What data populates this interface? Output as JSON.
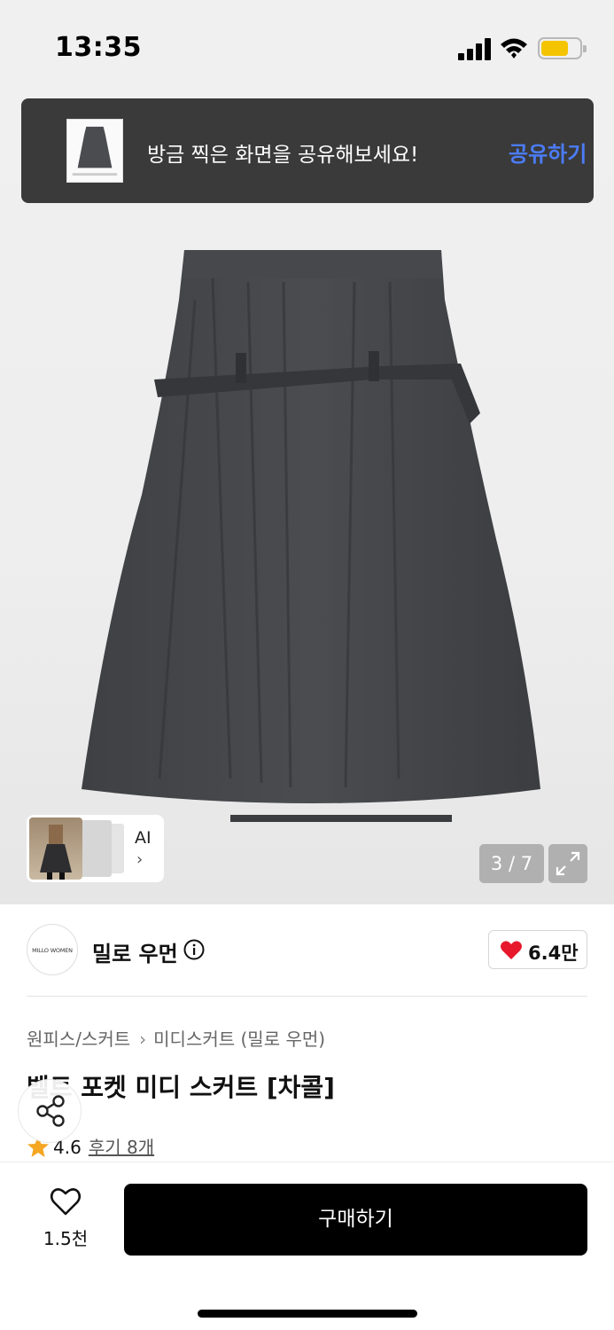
{
  "status_bar": {
    "time": "13:35",
    "battery_color": "#f5c400"
  },
  "toast": {
    "message": "방금 찍은 화면을 공유해보세요!",
    "action_label": "공유하기",
    "action_color": "#4b7cf6"
  },
  "gallery": {
    "counter": "3 / 7",
    "ai_label": "AI",
    "ai_chevron": "›",
    "expand_icon": "expand-icon"
  },
  "brand": {
    "logo_text": "MILLO WOMEN",
    "name": "밀로 우먼",
    "likes": "6.4만",
    "like_color": "#e8182c"
  },
  "product": {
    "breadcrumb": [
      "원피스/스커트",
      "미디스커트 (밀로 우먼)"
    ],
    "breadcrumb_separator": "›",
    "title": "벨트 포켓 미디 스커트 [차콜]",
    "rating": "4.6",
    "reviews": "후기 8개",
    "star_color": "#f5a623"
  },
  "bottom_bar": {
    "wish_count": "1.5천",
    "buy_label": "구매하기"
  }
}
